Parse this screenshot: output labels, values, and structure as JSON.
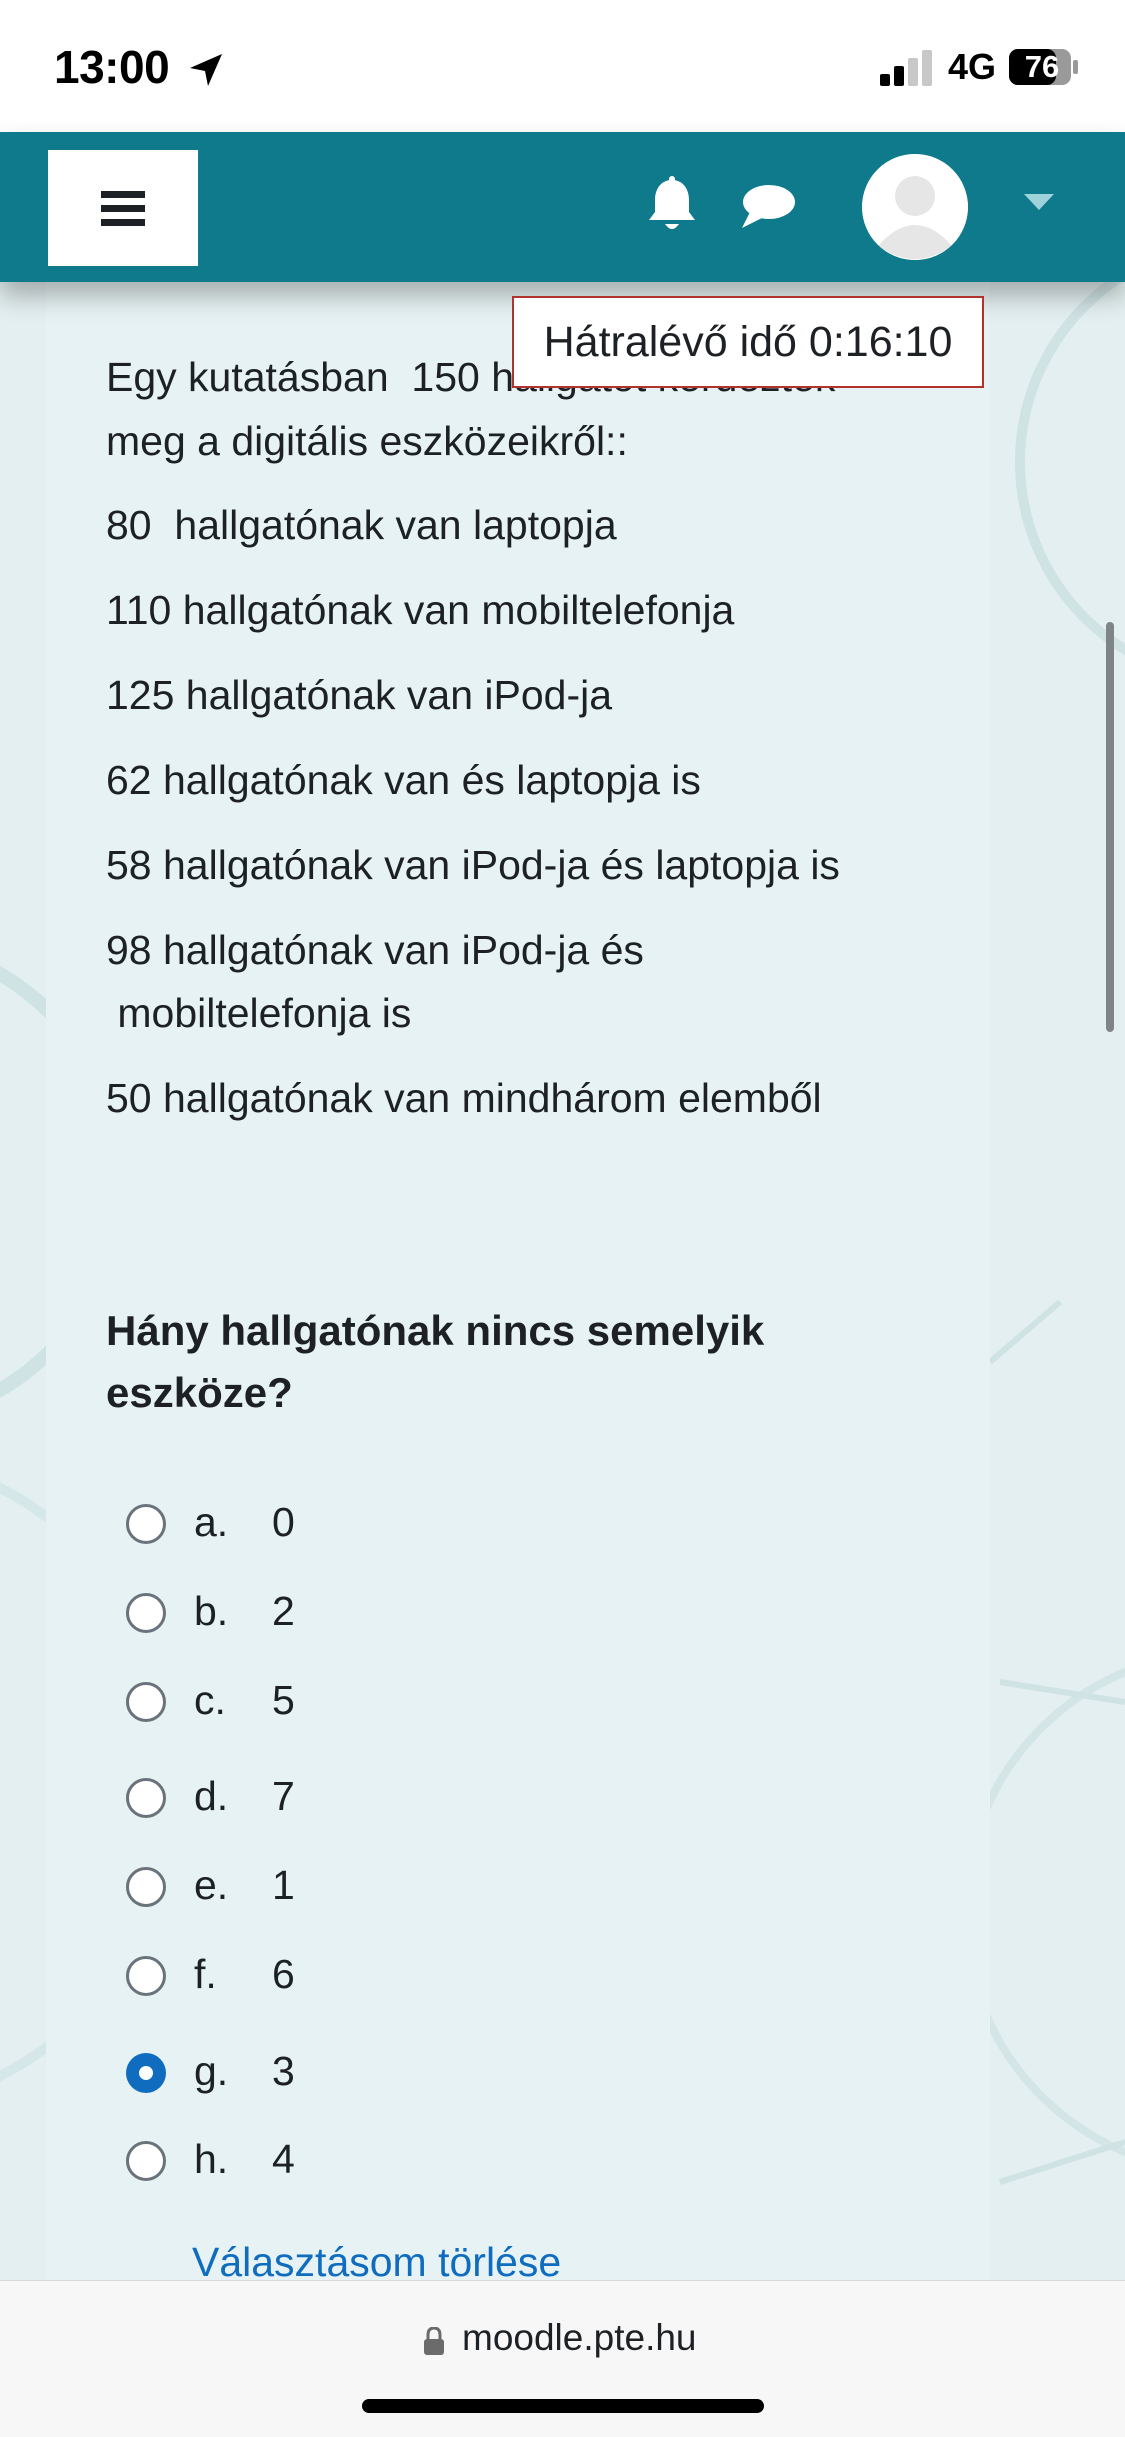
{
  "status_bar": {
    "time": "13:00",
    "network": "4G",
    "battery": "76",
    "battery_level": 0.76
  },
  "navbar": {
    "color": "#0f7a8c",
    "icons": [
      "menu-icon",
      "bell-icon",
      "chat-icon",
      "user-avatar-icon",
      "caret-down-icon"
    ]
  },
  "quiz": {
    "timer_label": "Hátralévő idő 0:16:10",
    "question_lines": [
      "Egy kutatásban  150 hallgatót kérdeztek",
      "meg a digitális eszközeikről::",
      "80  hallgatónak van laptopja",
      "110 hallgatónak van mobiltelefonja",
      "125 hallgatónak van iPod-ja",
      "62 hallgatónak van és laptopja is",
      "58 hallgatónak van iPod-ja és laptopja is",
      "98 hallgatónak van iPod-ja és",
      " mobiltelefonja is",
      "50 hallgatónak van mindhárom elemből"
    ],
    "question": "Hány hallgatónak nincs semelyik eszköze?",
    "options": [
      {
        "letter": "a.",
        "value": "0",
        "selected": false
      },
      {
        "letter": "b.",
        "value": "2",
        "selected": false
      },
      {
        "letter": "c.",
        "value": "5",
        "selected": false
      },
      {
        "letter": "d.",
        "value": "7",
        "selected": false
      },
      {
        "letter": "e.",
        "value": "1",
        "selected": false
      },
      {
        "letter": "f.",
        "value": "6",
        "selected": false
      },
      {
        "letter": "g.",
        "value": "3",
        "selected": true
      },
      {
        "letter": "h.",
        "value": "4",
        "selected": false
      }
    ],
    "clear_choice": "Választásom törlése"
  },
  "browser": {
    "url": "moodle.pte.hu"
  }
}
